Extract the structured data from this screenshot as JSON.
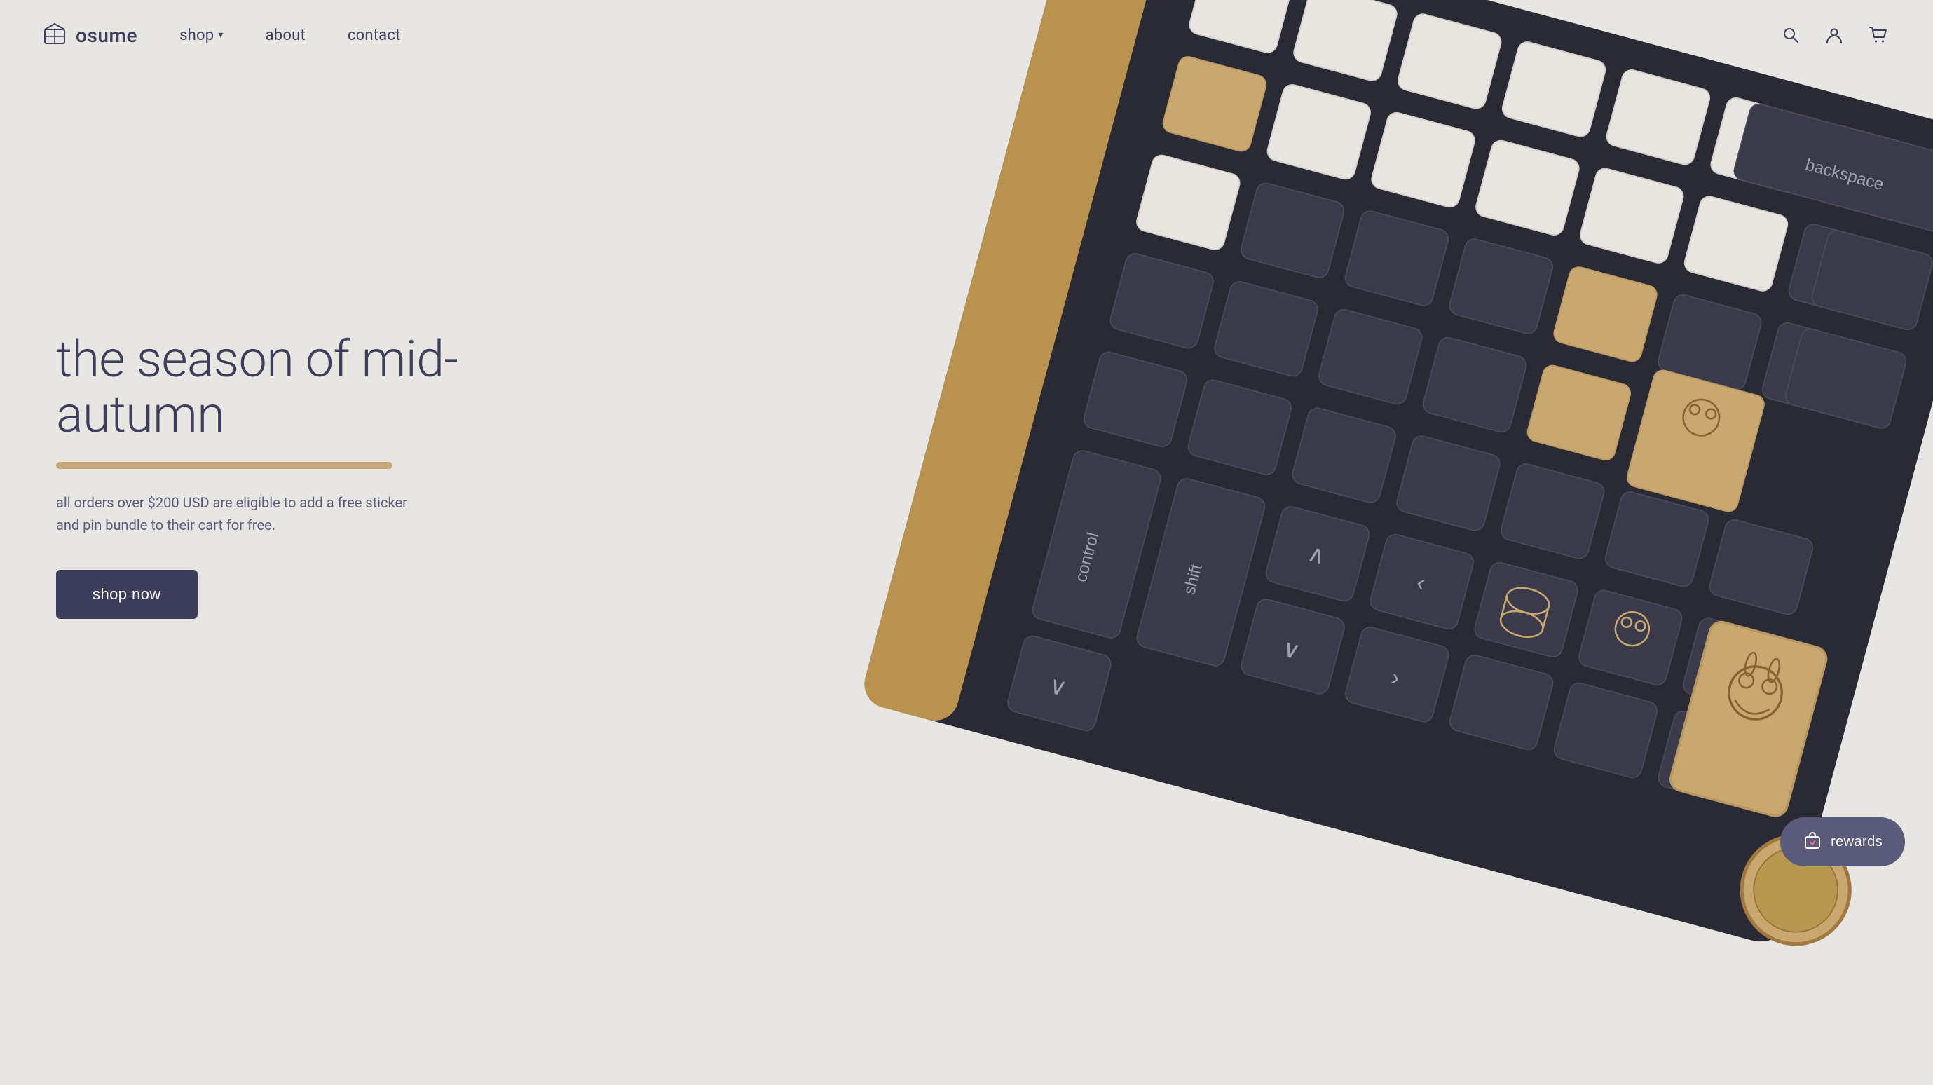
{
  "brand": {
    "name": "osume",
    "logo_alt": "osume logo"
  },
  "nav": {
    "links": [
      {
        "label": "shop",
        "has_dropdown": true,
        "href": "#"
      },
      {
        "label": "about",
        "has_dropdown": false,
        "href": "#"
      },
      {
        "label": "contact",
        "has_dropdown": false,
        "href": "#"
      }
    ],
    "icons": {
      "search": "search-icon",
      "account": "user-icon",
      "cart": "cart-icon"
    }
  },
  "hero": {
    "title": "the season of mid-autumn",
    "description": "all orders over $200 USD are eligible to add a free sticker and pin bundle to their cart for free.",
    "cta_label": "shop now",
    "divider_color": "#c9a97a"
  },
  "rewards": {
    "label": "rewards"
  },
  "colors": {
    "bg": "#e8e6e3",
    "text_dark": "#3d3d5c",
    "text_mid": "#5a5a7a",
    "accent": "#c9a97a",
    "btn_bg": "#3d3d5c",
    "btn_text": "#ffffff",
    "rewards_bg": "#5a5a7a"
  }
}
